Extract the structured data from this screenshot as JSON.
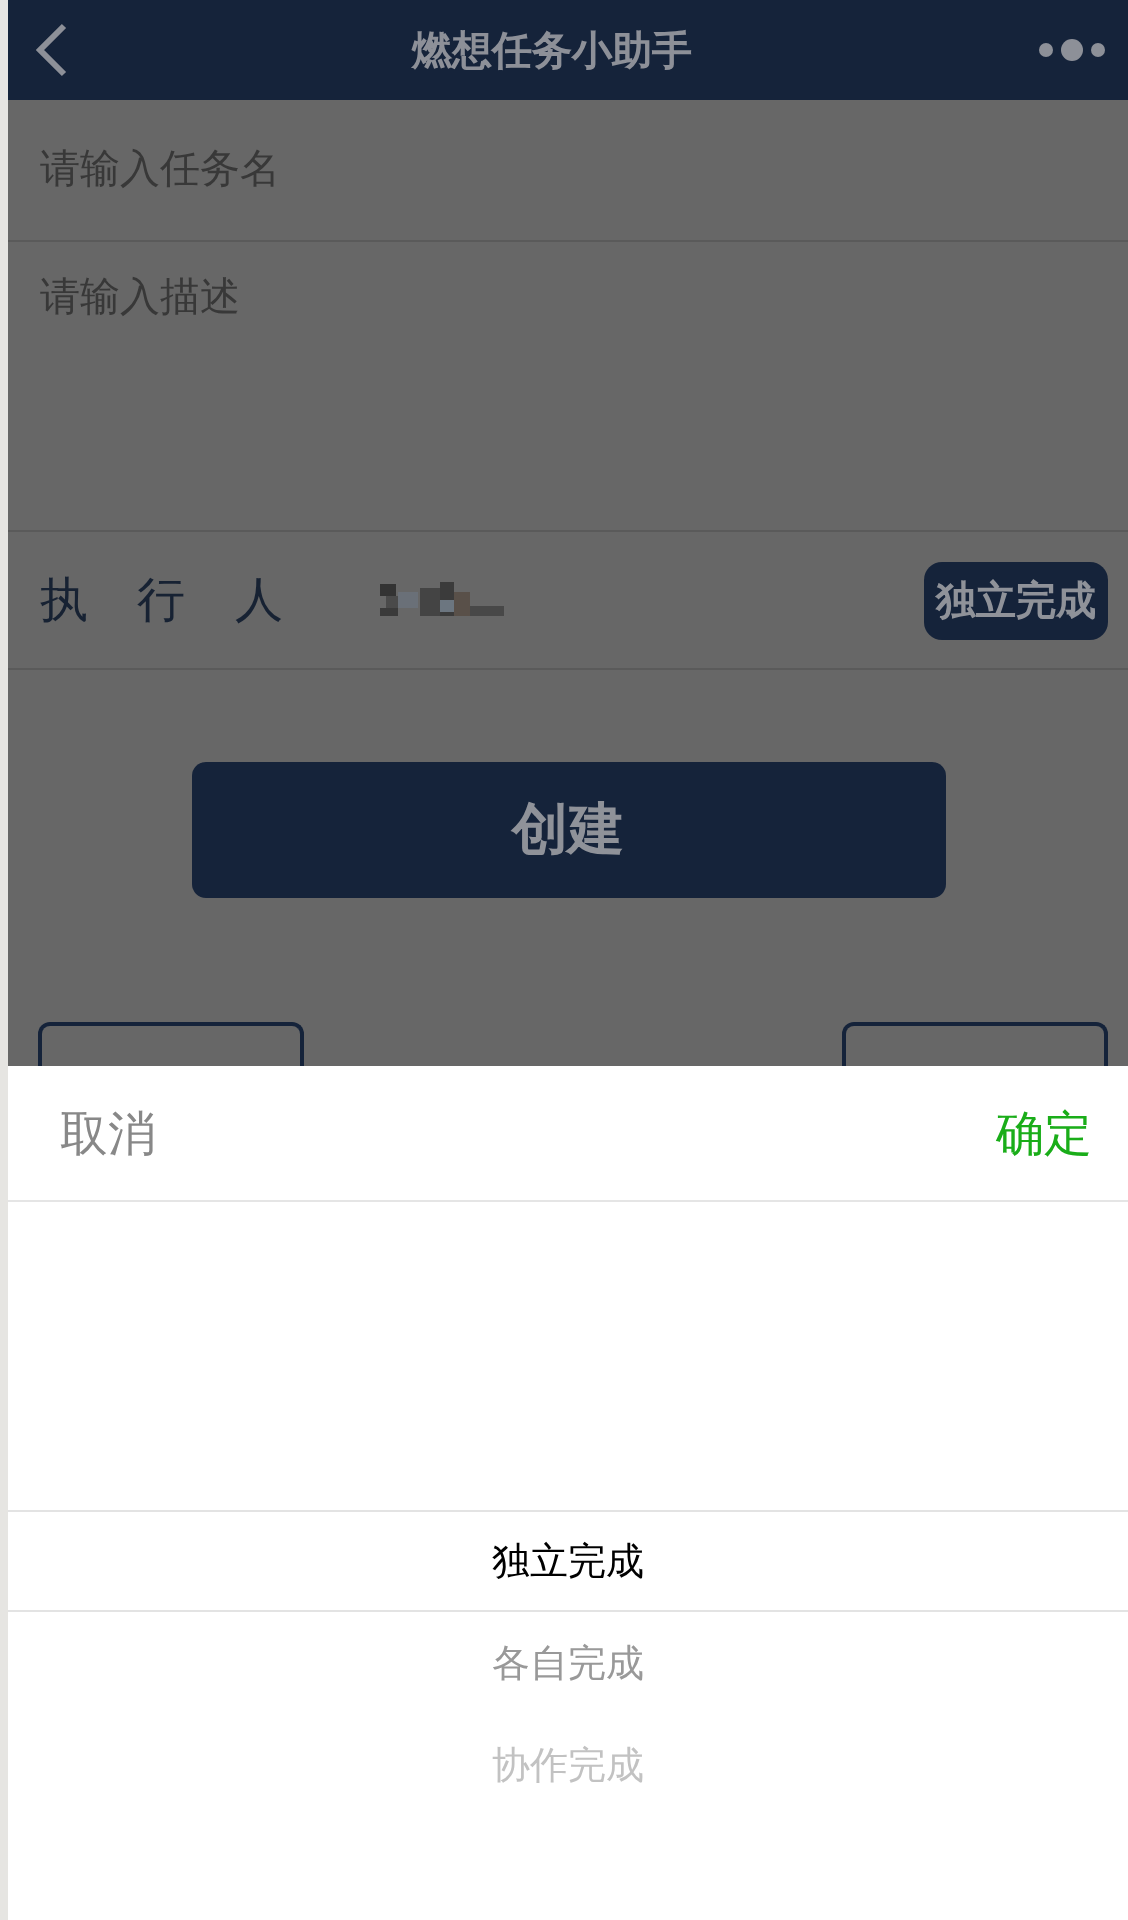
{
  "navbar": {
    "title": "燃想任务小助手"
  },
  "form": {
    "task_name": {
      "placeholder": "请输入任务名"
    },
    "description": {
      "placeholder": "请输入描述"
    },
    "executor": {
      "label": "执 行 人",
      "mode_button": "独立完成"
    },
    "create_button": "创建"
  },
  "picker": {
    "cancel": "取消",
    "confirm": "确定",
    "options": [
      {
        "label": "独立完成",
        "selected": true
      },
      {
        "label": "各自完成",
        "selected": false
      },
      {
        "label": "协作完成",
        "selected": false
      }
    ]
  }
}
